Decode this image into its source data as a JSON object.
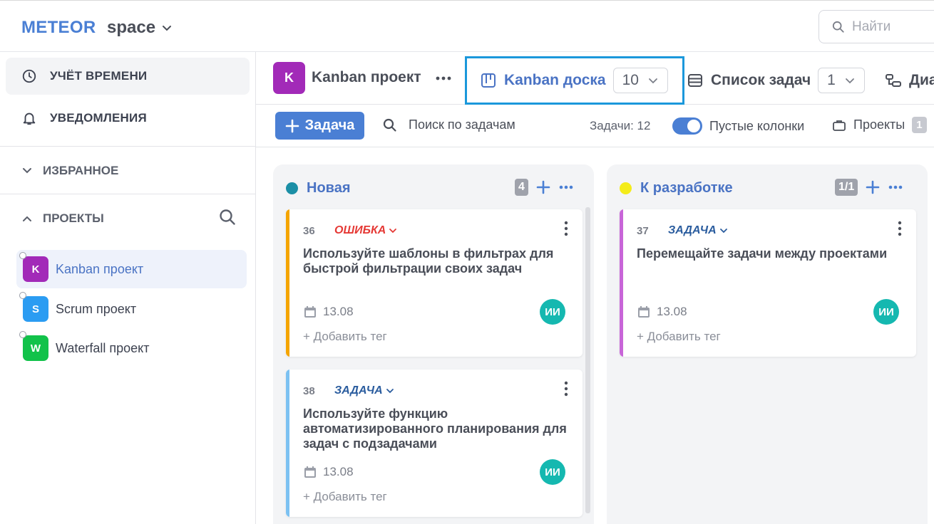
{
  "app": {
    "brand": "METEOR",
    "space": "space",
    "search_placeholder": "Найти"
  },
  "sidebar": {
    "time_tracking": "УЧЁТ ВРЕМЕНИ",
    "notifications": "УВЕДОМЛЕНИЯ",
    "favorites": "ИЗБРАННОЕ",
    "projects": "ПРОЕКТЫ",
    "project_list": [
      {
        "letter": "K",
        "name": "Kanban проект",
        "color": "#a22ab8",
        "selected": true
      },
      {
        "letter": "S",
        "name": "Scrum проект",
        "color": "#2b9cf2",
        "selected": false
      },
      {
        "letter": "W",
        "name": "Waterfall проект",
        "color": "#12c24a",
        "selected": false
      }
    ]
  },
  "project_header": {
    "badge": "K",
    "title": "Kanban проект",
    "tabs": [
      {
        "label": "Kanban доска",
        "count": "10",
        "active": true
      },
      {
        "label": "Список задач",
        "count": "1",
        "active": false
      },
      {
        "label": "Диа",
        "active": false
      }
    ]
  },
  "toolbar": {
    "add_task": "Задача",
    "search": "Поиск по задачам",
    "task_count": "Задачи: 12",
    "empty_columns": "Пустые колонки",
    "empty_columns_on": true,
    "projects": "Проекты",
    "projects_count": "1"
  },
  "columns": [
    {
      "title": "Новая",
      "dot_color": "#1b8fa6",
      "count": "4",
      "cards": [
        {
          "num": "36",
          "type": "ОШИБКА",
          "type_color": "#e53935",
          "stripe": "#f5a500",
          "title": "Используйте шаблоны в фильтрах для быстрой фильтрации своих задач",
          "date": "13.08",
          "assignee": "ИИ",
          "add_tag": "+ Добавить тег"
        },
        {
          "num": "38",
          "type": "ЗАДАЧА",
          "type_color": "#2a5c9e",
          "stripe": "#7cc1f2",
          "title": "Используйте функцию автоматизированного планирования для задач с подзадачами",
          "date": "13.08",
          "assignee": "ИИ",
          "add_tag": "+ Добавить тег"
        }
      ]
    },
    {
      "title": "К разработке",
      "dot_color": "#f4ec1a",
      "count": "1/1",
      "cards": [
        {
          "num": "37",
          "type": "ЗАДАЧА",
          "type_color": "#2a5c9e",
          "stripe": "#c865d8",
          "title": "Перемещайте задачи между проектами",
          "date": "13.08",
          "assignee": "ИИ",
          "add_tag": "+ Добавить тег"
        }
      ]
    }
  ]
}
